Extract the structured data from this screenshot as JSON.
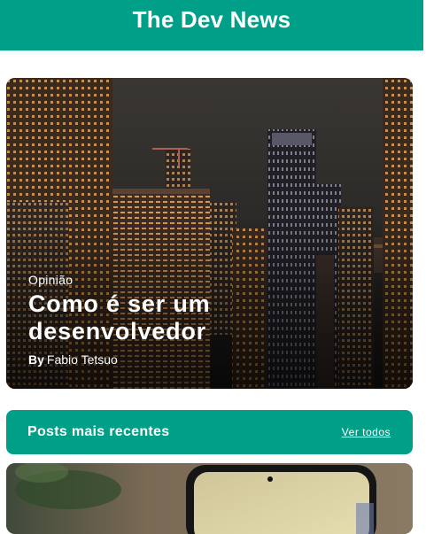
{
  "header": {
    "title": "The Dev News"
  },
  "featured": {
    "category": "Opinião",
    "title": "Como é ser um desenvolvedor",
    "by_label": "By",
    "author": "Fabio Tetsuo",
    "image": "city-skyline-night-photo"
  },
  "recent": {
    "title": "Posts mais recentes",
    "see_all": "Ver todos"
  },
  "post_preview": {
    "image": "smartphone-on-table-photo"
  },
  "colors": {
    "brand": "#00a088",
    "text_on_brand": "#ffffff"
  }
}
